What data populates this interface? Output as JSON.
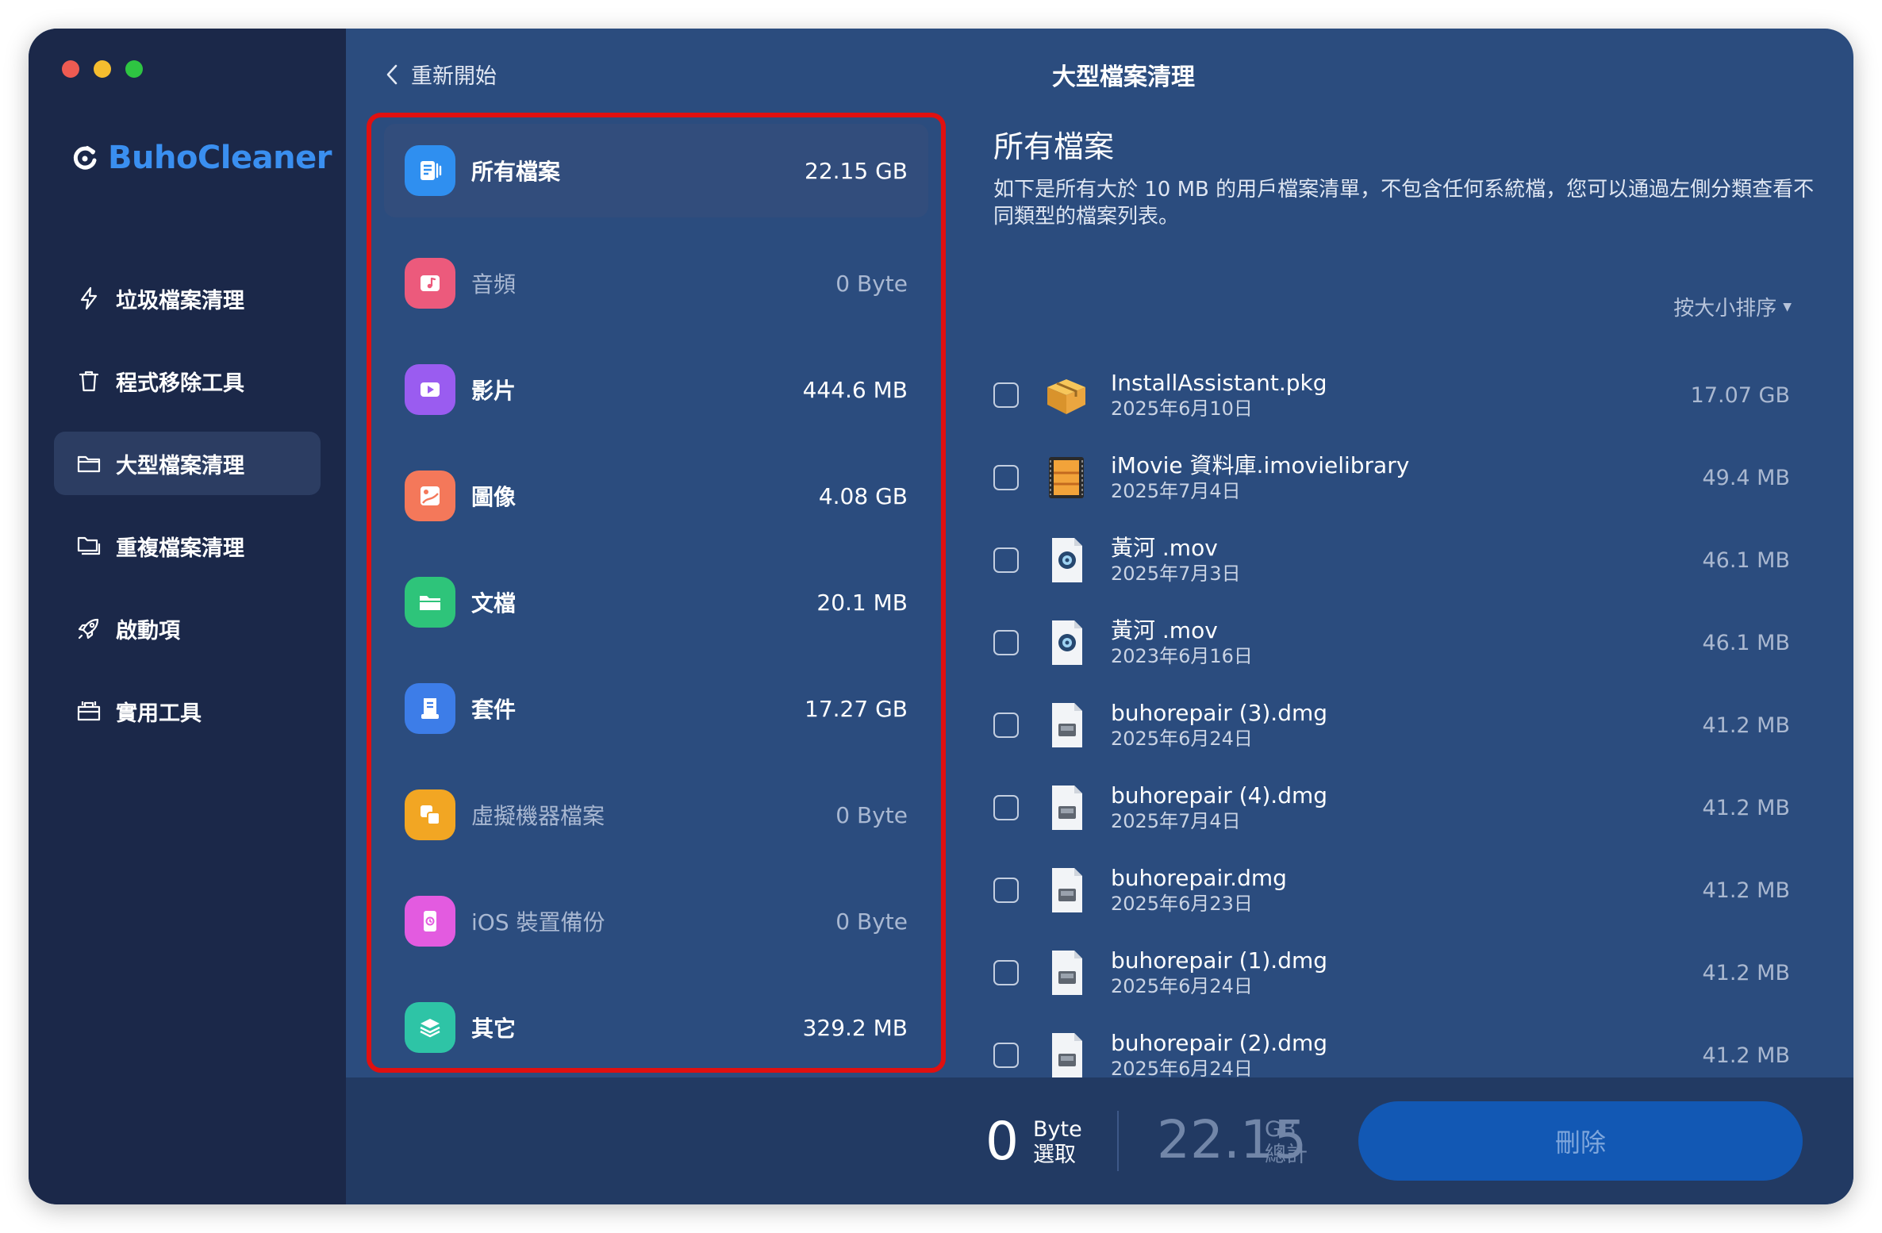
{
  "app": {
    "name": "BuhoCleaner"
  },
  "header": {
    "back_label": "重新開始",
    "title": "大型檔案清理"
  },
  "sidebar": {
    "items": [
      {
        "label": "垃圾檔案清理",
        "icon": "bolt-icon"
      },
      {
        "label": "程式移除工具",
        "icon": "trash-icon"
      },
      {
        "label": "大型檔案清理",
        "icon": "folder-icon",
        "active": true
      },
      {
        "label": "重複檔案清理",
        "icon": "duplicate-folder-icon"
      },
      {
        "label": "啟動項",
        "icon": "rocket-icon"
      },
      {
        "label": "實用工具",
        "icon": "toolbox-icon"
      }
    ]
  },
  "categories": [
    {
      "name": "所有檔案",
      "size": "22.15 GB",
      "icon": "all-files-icon",
      "color": "#2f8ff0",
      "active": true
    },
    {
      "name": "音頻",
      "size": "0 Byte",
      "icon": "music-icon",
      "color": "#ec5a7c",
      "dim": true
    },
    {
      "name": "影片",
      "size": "444.6 MB",
      "icon": "video-icon",
      "color": "#9a5cf0"
    },
    {
      "name": "圖像",
      "size": "4.08 GB",
      "icon": "image-icon",
      "color": "#f4785a"
    },
    {
      "name": "文檔",
      "size": "20.1 MB",
      "icon": "document-folder-icon",
      "color": "#2ec47a"
    },
    {
      "name": "套件",
      "size": "17.27 GB",
      "icon": "package-icon",
      "color": "#3d7de8"
    },
    {
      "name": "虛擬機器檔案",
      "size": "0 Byte",
      "icon": "virtual-machine-icon",
      "color": "#f2a623",
      "dim": true
    },
    {
      "name": "iOS 裝置備份",
      "size": "0 Byte",
      "icon": "ios-backup-icon",
      "color": "#e35be0",
      "dim": true
    },
    {
      "name": "其它",
      "size": "329.2 MB",
      "icon": "layers-icon",
      "color": "#2ec4a6"
    }
  ],
  "content": {
    "title": "所有檔案",
    "description": "如下是所有大於 10 MB 的用戶檔案清單，不包含任何系統檔，您可以通過左側分類查看不同類型的檔案列表。",
    "sort_label": "按大小排序"
  },
  "files": [
    {
      "name": "InstallAssistant.pkg",
      "date": "2025年6月10日",
      "size": "17.07 GB",
      "icon": "package-box-icon"
    },
    {
      "name": "iMovie 資料庫.imovielibrary",
      "date": "2025年7月4日",
      "size": "49.4 MB",
      "icon": "imovie-library-icon"
    },
    {
      "name": "黃河 .mov",
      "date": "2025年7月3日",
      "size": "46.1 MB",
      "icon": "mov-file-icon"
    },
    {
      "name": "黃河 .mov",
      "date": "2023年6月16日",
      "size": "46.1 MB",
      "icon": "mov-file-icon"
    },
    {
      "name": "buhorepair (3).dmg",
      "date": "2025年6月24日",
      "size": "41.2 MB",
      "icon": "dmg-file-icon"
    },
    {
      "name": "buhorepair (4).dmg",
      "date": "2025年7月4日",
      "size": "41.2 MB",
      "icon": "dmg-file-icon"
    },
    {
      "name": "buhorepair.dmg",
      "date": "2025年6月23日",
      "size": "41.2 MB",
      "icon": "dmg-file-icon"
    },
    {
      "name": "buhorepair (1).dmg",
      "date": "2025年6月24日",
      "size": "41.2 MB",
      "icon": "dmg-file-icon"
    },
    {
      "name": "buhorepair (2).dmg",
      "date": "2025年6月24日",
      "size": "41.2 MB",
      "icon": "dmg-file-icon"
    }
  ],
  "footer": {
    "selected_value": "0",
    "selected_unit": "Byte",
    "selected_label": "選取",
    "total_value": "22.15",
    "total_unit": "GB",
    "total_label": "總計",
    "delete_label": "刪除"
  }
}
